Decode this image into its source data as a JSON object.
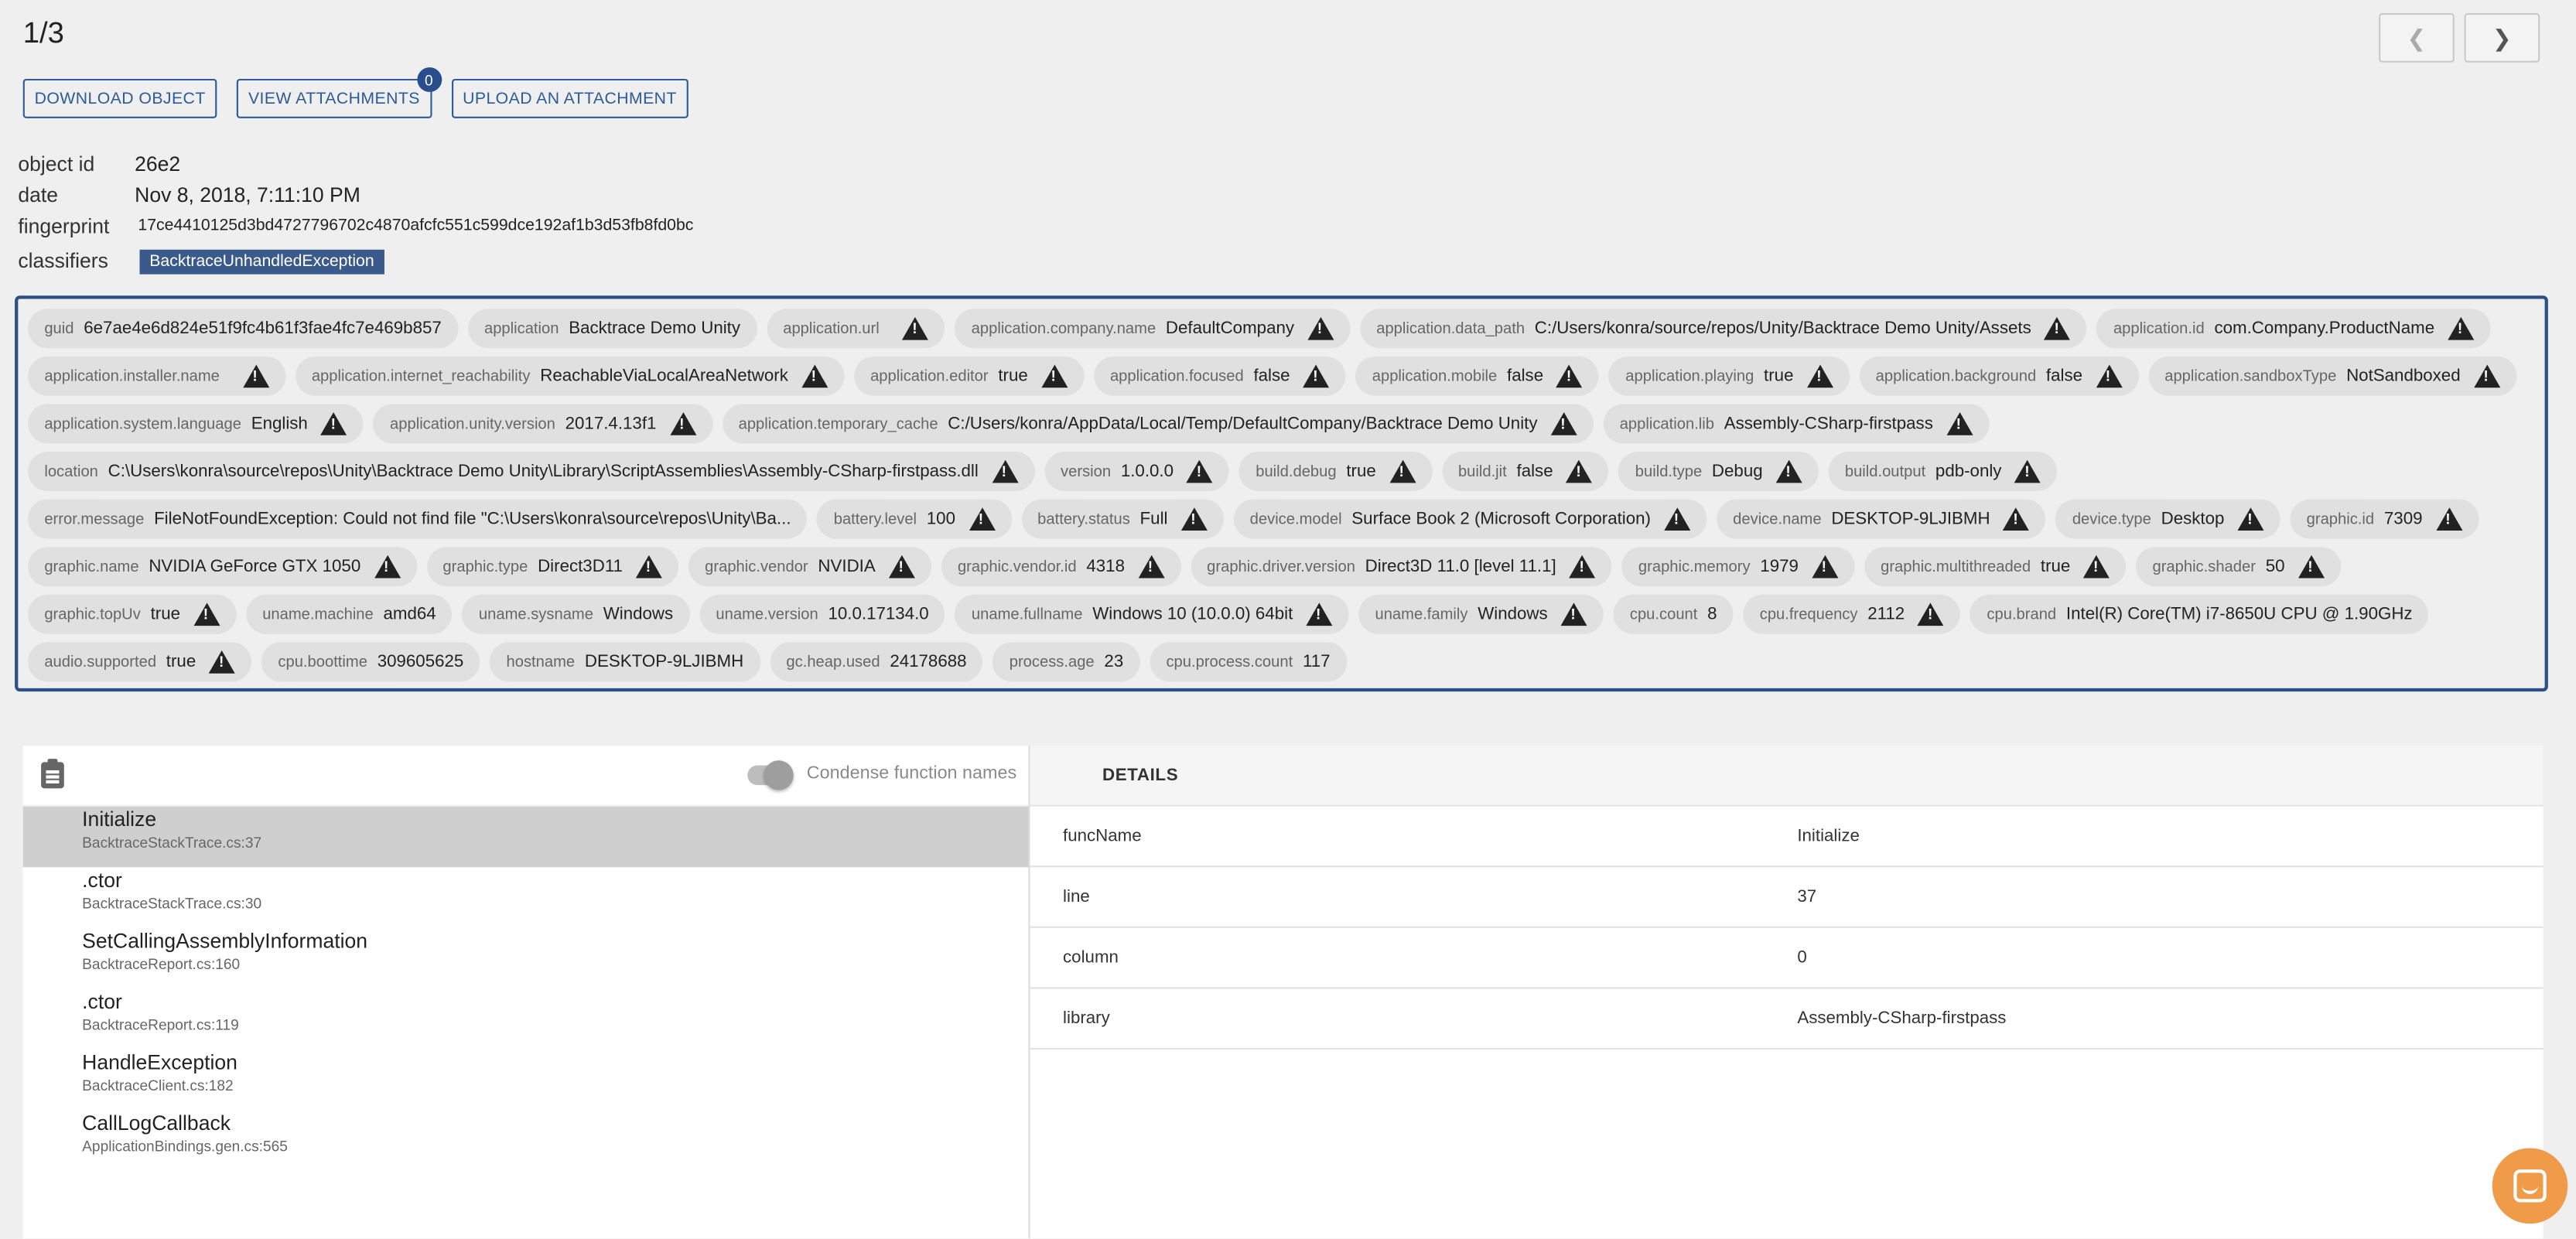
{
  "pager": {
    "label": "1/3"
  },
  "actions": {
    "download": "DOWNLOAD OBJECT",
    "view_attachments": "VIEW ATTACHMENTS",
    "attachments_count": "0",
    "upload": "UPLOAD AN ATTACHMENT"
  },
  "meta": {
    "object_id_label": "object id",
    "object_id": "26e2",
    "date_label": "date",
    "date": "Nov 8, 2018, 7:11:10 PM",
    "fingerprint_label": "fingerprint",
    "fingerprint": "17ce4410125d3bd4727796702c4870afcfc551c599dce192af1b3d53fb8fd0bc",
    "classifiers_label": "classifiers",
    "classifier": "BacktraceUnhandledException"
  },
  "attributes": [
    {
      "k": "guid",
      "v": "6e7ae4e6d824e51f9fc4b61f3fae4fc7e469b857",
      "warn": false
    },
    {
      "k": "application",
      "v": "Backtrace Demo Unity",
      "warn": false
    },
    {
      "k": "application.url",
      "v": "",
      "warn": true
    },
    {
      "k": "application.company.name",
      "v": "DefaultCompany",
      "warn": true
    },
    {
      "k": "application.data_path",
      "v": "C:/Users/konra/source/repos/Unity/Backtrace Demo Unity/Assets",
      "warn": true
    },
    {
      "k": "application.id",
      "v": "com.Company.ProductName",
      "warn": true
    },
    {
      "k": "application.installer.name",
      "v": "",
      "warn": true
    },
    {
      "k": "application.internet_reachability",
      "v": "ReachableViaLocalAreaNetwork",
      "warn": true
    },
    {
      "k": "application.editor",
      "v": "true",
      "warn": true
    },
    {
      "k": "application.focused",
      "v": "false",
      "warn": true
    },
    {
      "k": "application.mobile",
      "v": "false",
      "warn": true
    },
    {
      "k": "application.playing",
      "v": "true",
      "warn": true
    },
    {
      "k": "application.background",
      "v": "false",
      "warn": true
    },
    {
      "k": "application.sandboxType",
      "v": "NotSandboxed",
      "warn": true
    },
    {
      "k": "application.system.language",
      "v": "English",
      "warn": true
    },
    {
      "k": "application.unity.version",
      "v": "2017.4.13f1",
      "warn": true
    },
    {
      "k": "application.temporary_cache",
      "v": "C:/Users/konra/AppData/Local/Temp/DefaultCompany/Backtrace Demo Unity",
      "warn": true
    },
    {
      "k": "application.lib",
      "v": "Assembly-CSharp-firstpass",
      "warn": true
    },
    {
      "k": "location",
      "v": "C:\\Users\\konra\\source\\repos\\Unity\\Backtrace Demo Unity\\Library\\ScriptAssemblies\\Assembly-CSharp-firstpass.dll",
      "warn": true
    },
    {
      "k": "version",
      "v": "1.0.0.0",
      "warn": true
    },
    {
      "k": "build.debug",
      "v": "true",
      "warn": true
    },
    {
      "k": "build.jit",
      "v": "false",
      "warn": true
    },
    {
      "k": "build.type",
      "v": "Debug",
      "warn": true
    },
    {
      "k": "build.output",
      "v": "pdb-only",
      "warn": true
    },
    {
      "k": "error.message",
      "v": "FileNotFoundException: Could not find file \"C:\\Users\\konra\\source\\repos\\Unity\\Ba...",
      "warn": false
    },
    {
      "k": "battery.level",
      "v": "100",
      "warn": true
    },
    {
      "k": "battery.status",
      "v": "Full",
      "warn": true
    },
    {
      "k": "device.model",
      "v": "Surface Book 2 (Microsoft Corporation)",
      "warn": true
    },
    {
      "k": "device.name",
      "v": "DESKTOP-9LJIBMH",
      "warn": true
    },
    {
      "k": "device.type",
      "v": "Desktop",
      "warn": true
    },
    {
      "k": "graphic.id",
      "v": "7309",
      "warn": true
    },
    {
      "k": "graphic.name",
      "v": "NVIDIA GeForce GTX 1050",
      "warn": true
    },
    {
      "k": "graphic.type",
      "v": "Direct3D11",
      "warn": true
    },
    {
      "k": "graphic.vendor",
      "v": "NVIDIA",
      "warn": true
    },
    {
      "k": "graphic.vendor.id",
      "v": "4318",
      "warn": true
    },
    {
      "k": "graphic.driver.version",
      "v": "Direct3D 11.0 [level 11.1]",
      "warn": true
    },
    {
      "k": "graphic.memory",
      "v": "1979",
      "warn": true
    },
    {
      "k": "graphic.multithreaded",
      "v": "true",
      "warn": true
    },
    {
      "k": "graphic.shader",
      "v": "50",
      "warn": true
    },
    {
      "k": "graphic.topUv",
      "v": "true",
      "warn": true
    },
    {
      "k": "uname.machine",
      "v": "amd64",
      "warn": false
    },
    {
      "k": "uname.sysname",
      "v": "Windows",
      "warn": false
    },
    {
      "k": "uname.version",
      "v": "10.0.17134.0",
      "warn": false
    },
    {
      "k": "uname.fullname",
      "v": "Windows 10 (10.0.0) 64bit",
      "warn": true
    },
    {
      "k": "uname.family",
      "v": "Windows",
      "warn": true
    },
    {
      "k": "cpu.count",
      "v": "8",
      "warn": false
    },
    {
      "k": "cpu.frequency",
      "v": "2112",
      "warn": true
    },
    {
      "k": "cpu.brand",
      "v": "Intel(R) Core(TM) i7-8650U CPU @ 1.90GHz",
      "warn": false
    },
    {
      "k": "audio.supported",
      "v": "true",
      "warn": true
    },
    {
      "k": "cpu.boottime",
      "v": "309605625",
      "warn": false
    },
    {
      "k": "hostname",
      "v": "DESKTOP-9LJIBMH",
      "warn": false
    },
    {
      "k": "gc.heap.used",
      "v": "24178688",
      "warn": false
    },
    {
      "k": "process.age",
      "v": "23",
      "warn": false
    },
    {
      "k": "cpu.process.count",
      "v": "117",
      "warn": false
    }
  ],
  "stack": {
    "toggle_label": "Condense function names",
    "frames": [
      {
        "fn": "Initialize",
        "file": "BacktraceStackTrace.cs:37",
        "selected": true
      },
      {
        "fn": ".ctor",
        "file": "BacktraceStackTrace.cs:30",
        "selected": false
      },
      {
        "fn": "SetCallingAssemblyInformation",
        "file": "BacktraceReport.cs:160",
        "selected": false
      },
      {
        "fn": ".ctor",
        "file": "BacktraceReport.cs:119",
        "selected": false
      },
      {
        "fn": "HandleException",
        "file": "BacktraceClient.cs:182",
        "selected": false
      },
      {
        "fn": "CallLogCallback",
        "file": "ApplicationBindings.gen.cs:565",
        "selected": false
      }
    ]
  },
  "details": {
    "title": "DETAILS",
    "rows": [
      {
        "k": "funcName",
        "v": "Initialize"
      },
      {
        "k": "line",
        "v": "37"
      },
      {
        "k": "column",
        "v": "0"
      },
      {
        "k": "library",
        "v": "Assembly-CSharp-firstpass"
      }
    ]
  },
  "colors": {
    "accent": "#2c5b96",
    "classifier_bg": "#3a5a8c",
    "chat": "#f09b4a"
  }
}
